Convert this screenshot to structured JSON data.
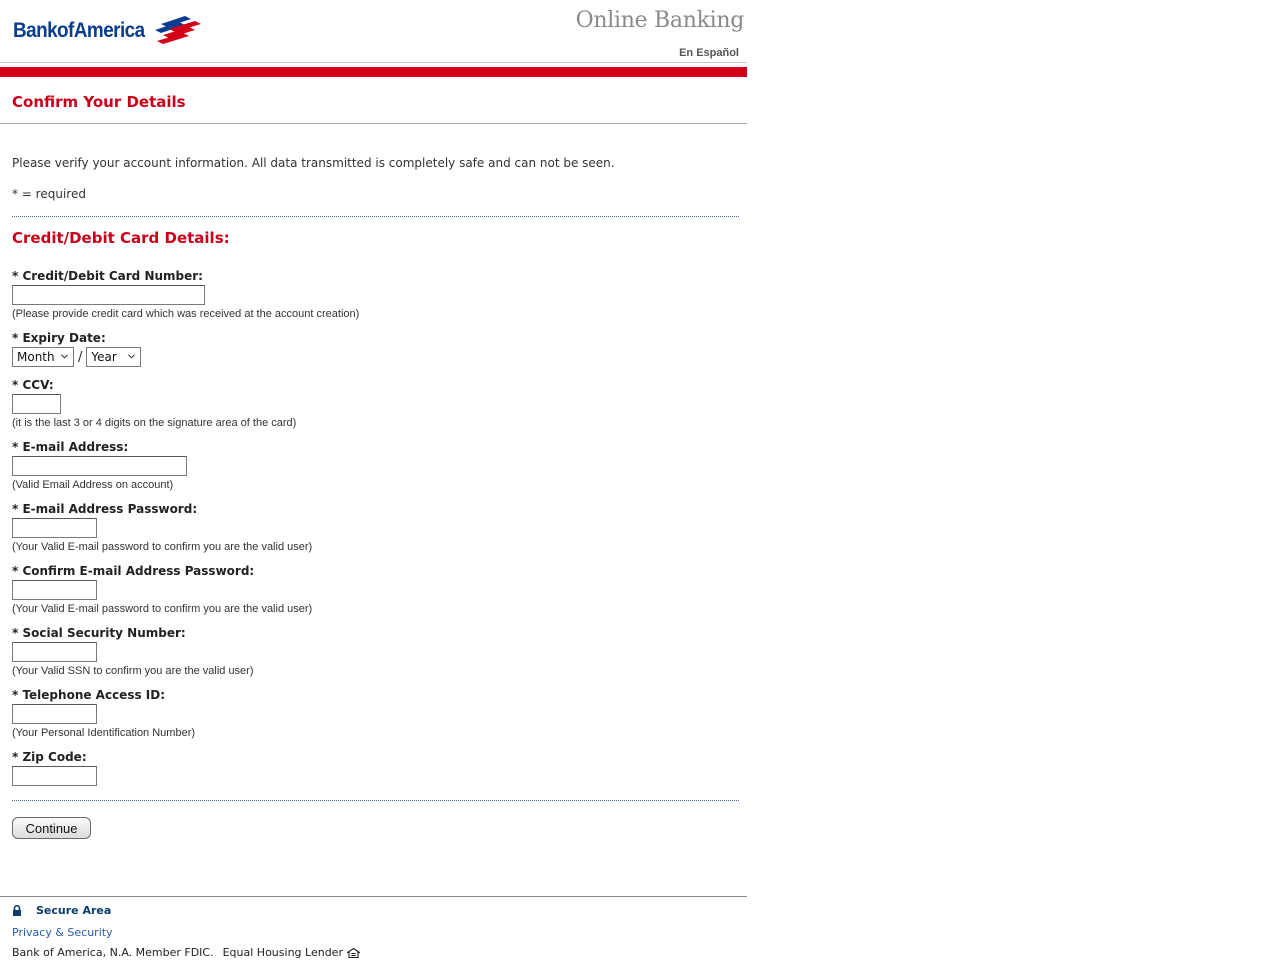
{
  "header": {
    "logo_text": "BankofAmerica",
    "section_title": "Online Banking",
    "language_link": "En Español"
  },
  "page": {
    "title": "Confirm Your Details",
    "intro": "Please verify your account information. All data transmitted is completely safe and can not be seen.",
    "required_note": "* = required",
    "section_title": "Credit/Debit Card Details:"
  },
  "fields": {
    "card_number": {
      "label": "* Credit/Debit Card Number:",
      "hint": "(Please provide credit card which was received at the account creation)",
      "value": ""
    },
    "expiry": {
      "label": "* Expiry Date:",
      "month": "Month",
      "separator": "/",
      "year": "Year"
    },
    "ccv": {
      "label": "* CCV:",
      "hint": "(it is the last 3 or 4 digits on the signature area of the card)",
      "value": ""
    },
    "email": {
      "label": "* E-mail Address:",
      "hint": "(Valid Email Address on account)",
      "value": ""
    },
    "email_password": {
      "label": "* E-mail Address Password:",
      "hint": "(Your Valid E-mail password to confirm you are the valid user)",
      "value": ""
    },
    "confirm_email_password": {
      "label": "* Confirm E-mail Address Password:",
      "hint": "(Your Valid E-mail password to confirm you are the valid user)",
      "value": ""
    },
    "ssn": {
      "label": "* Social Security Number:",
      "hint": "(Your Valid SSN to confirm you are the valid user)",
      "value": ""
    },
    "telephone_access_id": {
      "label": "* Telephone Access ID:",
      "hint": "(Your Personal Identification Number)",
      "value": ""
    },
    "zip": {
      "label": "* Zip Code:",
      "value": ""
    }
  },
  "continue_button": "Continue",
  "footer": {
    "secure_area": "Secure Area",
    "privacy": "Privacy & Security",
    "member": "Bank of America, N.A. Member FDIC.",
    "equal_housing": "Equal Housing Lender"
  },
  "colors": {
    "brand_red": "#d4001a",
    "brand_blue": "#0a3d8f",
    "heading_red": "#c8001a",
    "link_blue": "#2a5aa8"
  },
  "icons": [
    "flag-logo-icon",
    "chevron-down-icon",
    "lock-icon",
    "equal-housing-icon"
  ]
}
